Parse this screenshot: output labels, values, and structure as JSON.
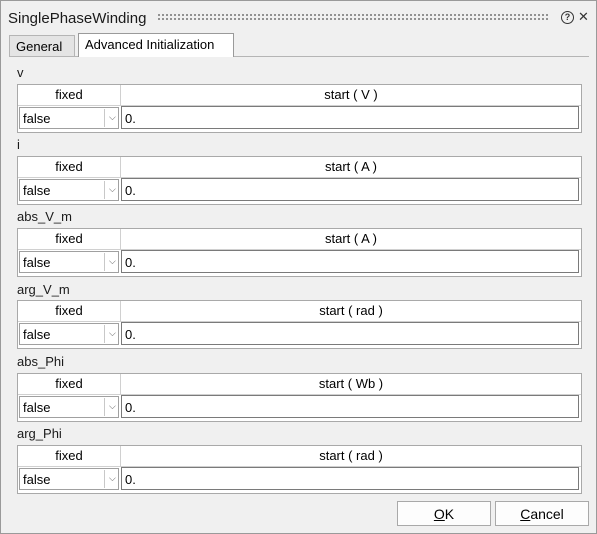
{
  "window": {
    "title": "SinglePhaseWinding"
  },
  "tabs": [
    {
      "label": "General"
    },
    {
      "label": "Advanced Initialization",
      "selected": true
    }
  ],
  "columns": {
    "fixed": "fixed"
  },
  "parameters": [
    {
      "name": "v",
      "start_header": "start ( V )",
      "fixed_value": "false",
      "start_value": "0."
    },
    {
      "name": "i",
      "start_header": "start ( A )",
      "fixed_value": "false",
      "start_value": "0."
    },
    {
      "name": "abs_V_m",
      "start_header": "start ( A )",
      "fixed_value": "false",
      "start_value": "0."
    },
    {
      "name": "arg_V_m",
      "start_header": "start ( rad )",
      "fixed_value": "false",
      "start_value": "0."
    },
    {
      "name": "abs_Phi",
      "start_header": "start ( Wb )",
      "fixed_value": "false",
      "start_value": "0."
    },
    {
      "name": "arg_Phi",
      "start_header": "start ( rad )",
      "fixed_value": "false",
      "start_value": "0."
    }
  ],
  "buttons": {
    "ok_mnemonic": "O",
    "ok_rest": "K",
    "cancel_mnemonic": "C",
    "cancel_rest": "ancel"
  },
  "icons": {
    "help": "help-icon",
    "close": "close-icon",
    "dropdown": "chevron-down-icon"
  }
}
